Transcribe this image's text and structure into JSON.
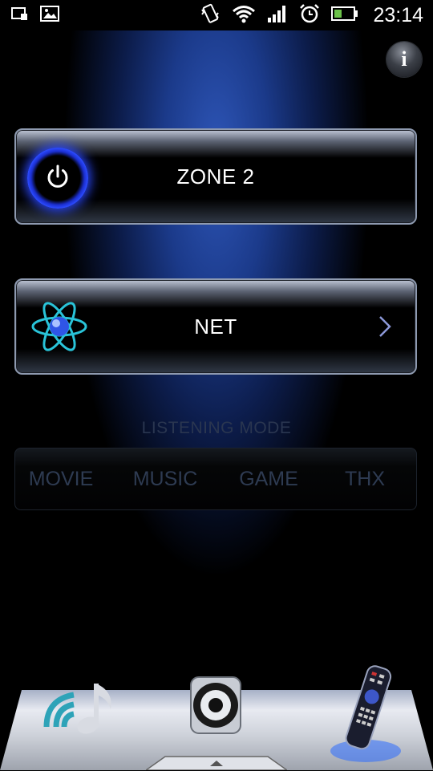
{
  "status_bar": {
    "time": "23:14",
    "icons": [
      "screenshot-icon",
      "image-icon",
      "vibrate-icon",
      "wifi-icon",
      "signal-icon",
      "alarm-icon",
      "battery-icon"
    ]
  },
  "info_button": {
    "label": "i"
  },
  "zone_panel": {
    "label": "ZONE 2",
    "icon": "power-icon"
  },
  "net_panel": {
    "label": "NET",
    "icon": "atom-icon"
  },
  "listening_mode": {
    "title": "LISTENING MODE",
    "modes": [
      "MOVIE",
      "MUSIC",
      "GAME",
      "THX"
    ]
  },
  "dock": {
    "items": [
      "music-stream-icon",
      "speaker-icon",
      "remote-control-icon"
    ]
  },
  "colors": {
    "accent_blue": "#2a47ff",
    "disabled_text": "#2e3b52"
  }
}
